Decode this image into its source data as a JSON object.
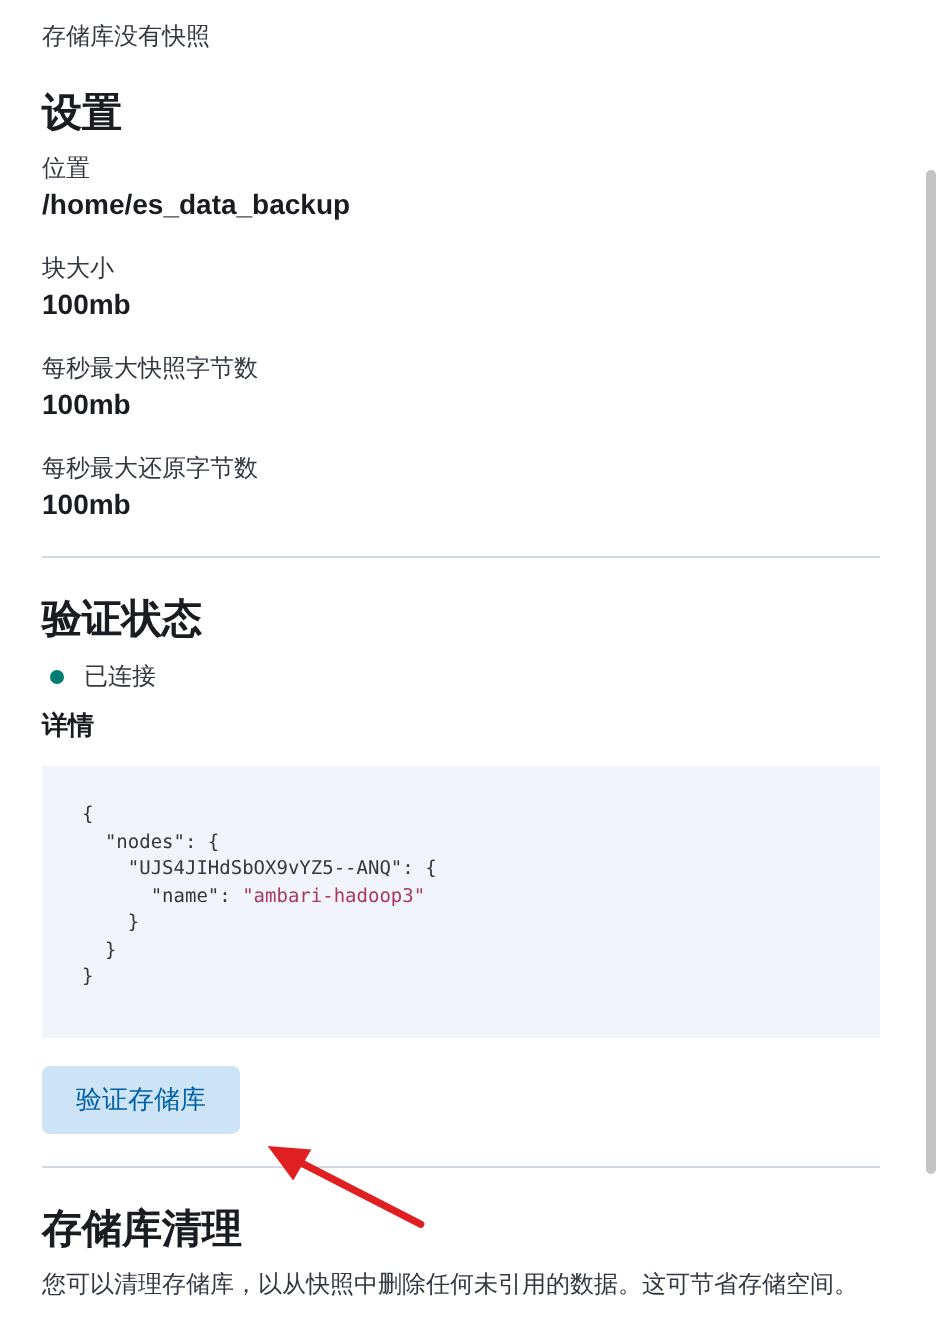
{
  "snapshots_note": "存储库没有快照",
  "settings": {
    "title": "设置",
    "fields": [
      {
        "label": "位置",
        "value": "/home/es_data_backup"
      },
      {
        "label": "块大小",
        "value": "100mb"
      },
      {
        "label": "每秒最大快照字节数",
        "value": "100mb"
      },
      {
        "label": "每秒最大还原字节数",
        "value": "100mb"
      }
    ]
  },
  "verification": {
    "title": "验证状态",
    "status": {
      "label": "已连接",
      "color": "#017d73"
    },
    "details_label": "详情",
    "code_lines": [
      {
        "text": "{"
      },
      {
        "text": "  \"nodes\": {"
      },
      {
        "text": "    \"UJS4JIHdSbOX9vYZ5--ANQ\": {"
      },
      {
        "text": "      \"name\": ",
        "value": "\"ambari-hadoop3\""
      },
      {
        "text": "    }"
      },
      {
        "text": "  }"
      },
      {
        "text": "}"
      }
    ],
    "button": "验证存储库"
  },
  "cleanup": {
    "title": "存储库清理",
    "description": "您可以清理存储库，以从快照中删除任何未引用的数据。这可节省存储空间。"
  }
}
